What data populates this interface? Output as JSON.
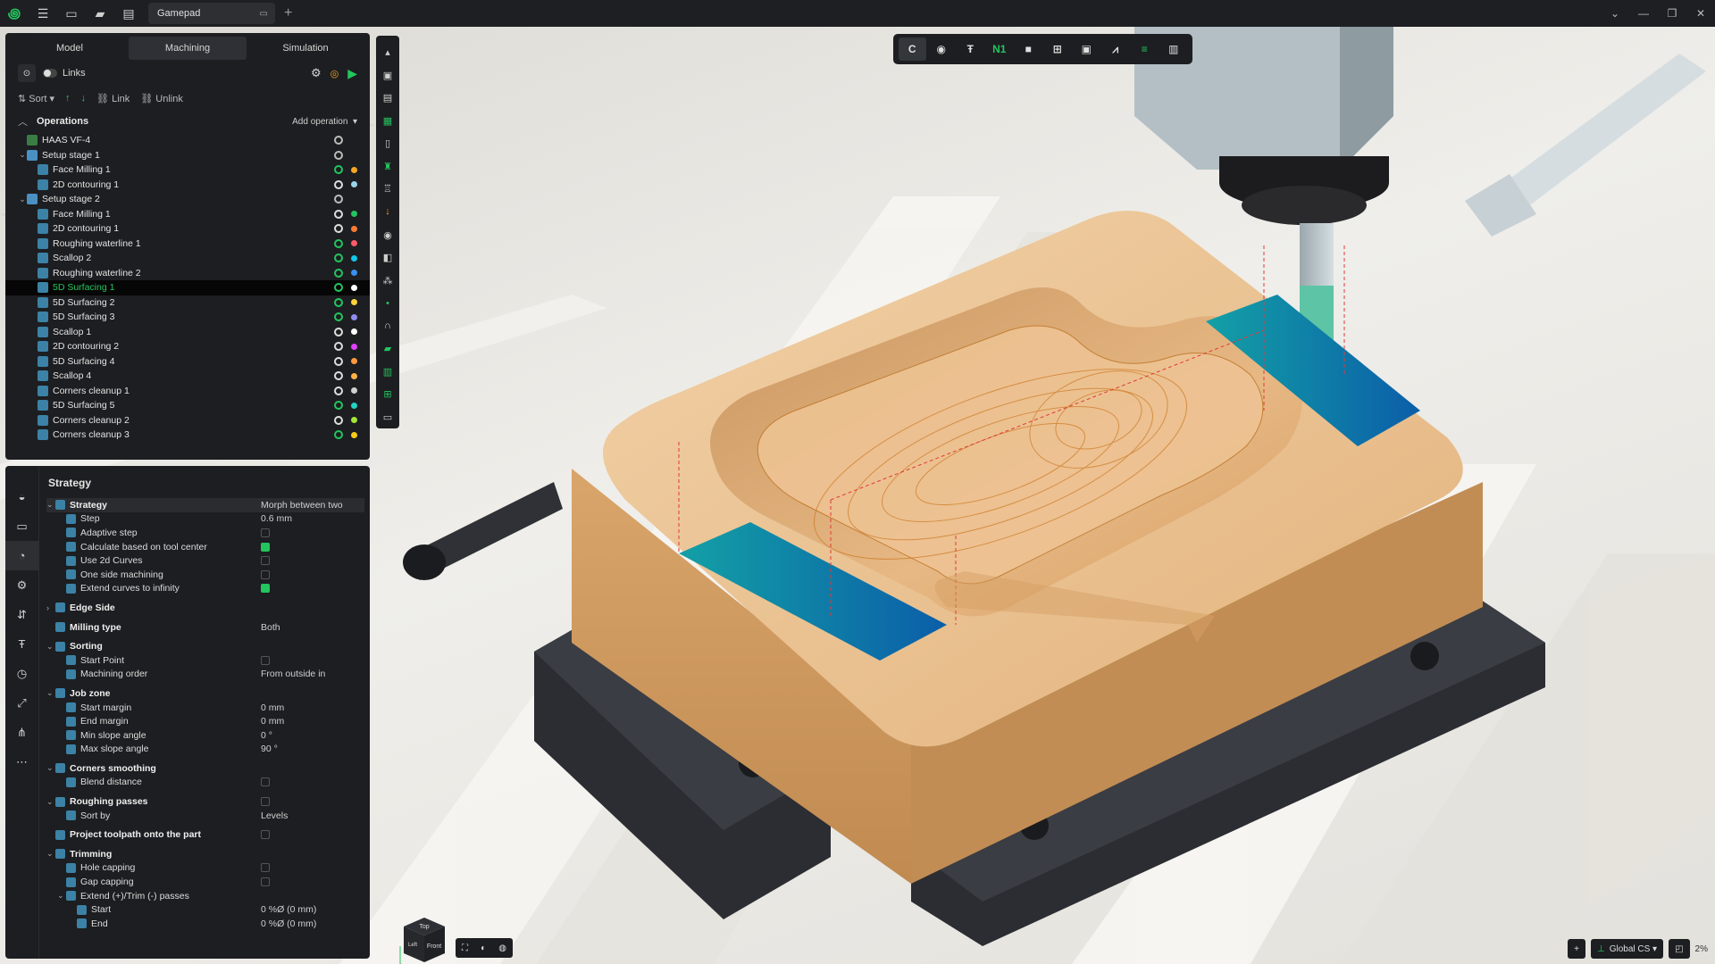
{
  "titlebar": {
    "doc_name": "Gamepad",
    "add_tab": "+"
  },
  "mode_tabs": [
    {
      "label": "Model"
    },
    {
      "label": "Machining"
    },
    {
      "label": "Simulation"
    }
  ],
  "links": {
    "label": "Links"
  },
  "sortbar": {
    "sort": "Sort",
    "link": "Link",
    "unlink": "Unlink"
  },
  "operations": {
    "title": "Operations",
    "add": "Add operation",
    "items": [
      {
        "label": "HAAS VF-4",
        "level": 0,
        "chev": "",
        "status": "def",
        "color": "",
        "icon": "#3a7d44"
      },
      {
        "label": "Setup stage 1",
        "level": 0,
        "chev": "⌄",
        "status": "def",
        "color": "",
        "icon": "#4a90c2"
      },
      {
        "label": "Face Milling 1",
        "level": 1,
        "chev": "",
        "status": "ok",
        "color": "#f5a623",
        "icon": "#3b82a6"
      },
      {
        "label": "2D contouring 1",
        "level": 1,
        "chev": "",
        "status": "plain",
        "color": "#9ad3ea",
        "icon": "#3b82a6"
      },
      {
        "label": "Setup stage 2",
        "level": 0,
        "chev": "⌄",
        "status": "def",
        "color": "",
        "icon": "#4a90c2"
      },
      {
        "label": "Face Milling 1",
        "level": 1,
        "chev": "",
        "status": "plain",
        "color": "#22c55e",
        "icon": "#3b82a6"
      },
      {
        "label": "2D contouring 1",
        "level": 1,
        "chev": "",
        "status": "plain",
        "color": "#ff7a30",
        "icon": "#3b82a6"
      },
      {
        "label": "Roughing waterline 1",
        "level": 1,
        "chev": "",
        "status": "ok",
        "color": "#ff5a6a",
        "icon": "#3b82a6"
      },
      {
        "label": "Scallop 2",
        "level": 1,
        "chev": "",
        "status": "ok",
        "color": "#12c6e6",
        "icon": "#3b82a6"
      },
      {
        "label": "Roughing waterline 2",
        "level": 1,
        "chev": "",
        "status": "ok",
        "color": "#3b8ff0",
        "icon": "#3b82a6"
      },
      {
        "label": "5D Surfacing 1",
        "level": 1,
        "chev": "",
        "status": "ok",
        "color": "#ffffff",
        "icon": "#3b82a6",
        "selected": true
      },
      {
        "label": "5D Surfacing 2",
        "level": 1,
        "chev": "",
        "status": "ok",
        "color": "#ffd23a",
        "icon": "#3b82a6"
      },
      {
        "label": "5D Surfacing 3",
        "level": 1,
        "chev": "",
        "status": "ok",
        "color": "#8f8cf2",
        "icon": "#3b82a6"
      },
      {
        "label": "Scallop 1",
        "level": 1,
        "chev": "",
        "status": "plain",
        "color": "#ffffff",
        "icon": "#3b82a6"
      },
      {
        "label": "2D contouring 2",
        "level": 1,
        "chev": "",
        "status": "plain",
        "color": "#e040fb",
        "icon": "#3b82a6"
      },
      {
        "label": "5D Surfacing 4",
        "level": 1,
        "chev": "",
        "status": "plain",
        "color": "#ff9a3c",
        "icon": "#3b82a6"
      },
      {
        "label": "Scallop 4",
        "level": 1,
        "chev": "",
        "status": "plain",
        "color": "#ffb347",
        "icon": "#3b82a6"
      },
      {
        "label": "Corners cleanup 1",
        "level": 1,
        "chev": "",
        "status": "plain",
        "color": "#d0d0d0",
        "icon": "#3b82a6"
      },
      {
        "label": "5D Surfacing 5",
        "level": 1,
        "chev": "",
        "status": "ok",
        "color": "#22d3c5",
        "icon": "#3b82a6"
      },
      {
        "label": "Corners cleanup 2",
        "level": 1,
        "chev": "",
        "status": "plain",
        "color": "#a3e635",
        "icon": "#3b82a6"
      },
      {
        "label": "Corners cleanup 3",
        "level": 1,
        "chev": "",
        "status": "ok",
        "color": "#facc15",
        "icon": "#3b82a6"
      }
    ]
  },
  "strategy": {
    "title": "Strategy",
    "props": [
      {
        "name": "Strategy",
        "bold": true,
        "level": 0,
        "chev": "⌄",
        "value": "Morph between two",
        "hl": true
      },
      {
        "name": "Step",
        "level": 1,
        "value": "0.6 mm"
      },
      {
        "name": "Adaptive step",
        "level": 1,
        "check": false
      },
      {
        "name": "Calculate based on tool center",
        "level": 1,
        "check": true
      },
      {
        "name": "Use 2d Curves",
        "level": 1,
        "check": false
      },
      {
        "name": "One side machining",
        "level": 1,
        "check": false
      },
      {
        "name": "Extend curves to infinity",
        "level": 1,
        "check": true
      },
      {
        "name": "Edge Side",
        "bold": true,
        "level": 0,
        "chev": "›",
        "gap": true
      },
      {
        "name": "Milling type",
        "bold": true,
        "level": 0,
        "value": "Both",
        "gap": true
      },
      {
        "name": "Sorting",
        "bold": true,
        "level": 0,
        "chev": "⌄",
        "gap": true
      },
      {
        "name": "Start Point",
        "level": 1,
        "check": false
      },
      {
        "name": "Machining order",
        "level": 1,
        "value": "From outside in"
      },
      {
        "name": "Job zone",
        "bold": true,
        "level": 0,
        "chev": "⌄",
        "gap": true
      },
      {
        "name": "Start margin",
        "level": 1,
        "value": "0 mm"
      },
      {
        "name": "End margin",
        "level": 1,
        "value": "0 mm"
      },
      {
        "name": "Min slope angle",
        "level": 1,
        "value": "0 °"
      },
      {
        "name": "Max slope angle",
        "level": 1,
        "value": "90 °"
      },
      {
        "name": "Corners smoothing",
        "bold": true,
        "level": 0,
        "chev": "⌄",
        "gap": true
      },
      {
        "name": "Blend distance",
        "level": 1,
        "check": false
      },
      {
        "name": "Roughing passes",
        "bold": true,
        "level": 0,
        "chev": "⌄",
        "gap": true,
        "check": false
      },
      {
        "name": "Sort by",
        "level": 1,
        "value": "Levels"
      },
      {
        "name": "Project toolpath onto the part",
        "bold": true,
        "level": 0,
        "check": false,
        "gap": true
      },
      {
        "name": "Trimming",
        "bold": true,
        "level": 0,
        "chev": "⌄",
        "gap": true
      },
      {
        "name": "Hole capping",
        "level": 1,
        "check": false
      },
      {
        "name": "Gap capping",
        "level": 1,
        "check": false
      },
      {
        "name": "Extend (+)/Trim (-) passes",
        "level": 1,
        "chev": "⌄"
      },
      {
        "name": "Start",
        "level": 2,
        "value": "0 %Ø (0 mm)"
      },
      {
        "name": "End",
        "level": 2,
        "value": "0 %Ø (0 mm)"
      }
    ]
  },
  "top_toolbar": [
    {
      "glyph": "C",
      "icon": "toolpath-display-icon",
      "active": true
    },
    {
      "glyph": "◉",
      "icon": "tool-display-icon"
    },
    {
      "glyph": "Ŧ",
      "icon": "holder-icon"
    },
    {
      "glyph": "N1",
      "icon": "nc-program-icon",
      "green": true
    },
    {
      "glyph": "■",
      "icon": "stock-icon"
    },
    {
      "glyph": "⊞",
      "icon": "fixture-icon"
    },
    {
      "glyph": "▣",
      "icon": "machine-icon"
    },
    {
      "glyph": "⩘",
      "icon": "curves-icon"
    },
    {
      "glyph": "≡",
      "icon": "layers-icon",
      "green": true
    },
    {
      "glyph": "▥",
      "icon": "statistics-icon"
    }
  ],
  "status": {
    "cs": "Global CS",
    "zoom": "2%"
  },
  "viewcube": {
    "top": "Top",
    "front": "Front",
    "left": "Left"
  },
  "colors": {
    "accent": "#22c55e",
    "panel": "#1d1e21",
    "part": "#e8be8d"
  }
}
